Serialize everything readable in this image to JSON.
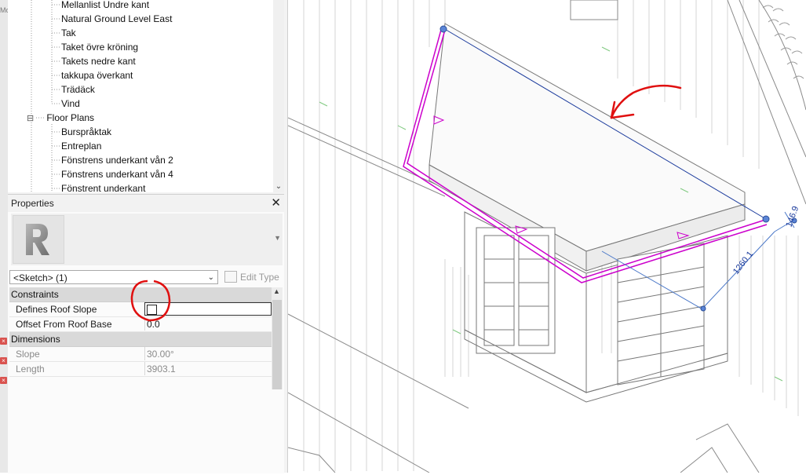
{
  "gutter": {
    "cut_label": "Mo",
    "error_marks": [
      "×",
      "×",
      "×"
    ]
  },
  "browser": {
    "items": [
      {
        "label": "Mellanlist Undre kant"
      },
      {
        "label": "Natural Ground Level East"
      },
      {
        "label": "Tak"
      },
      {
        "label": "Taket övre kröning"
      },
      {
        "label": "Takets nedre kant"
      },
      {
        "label": "takkupa överkant"
      },
      {
        "label": "Trädäck"
      },
      {
        "label": "Vind"
      },
      {
        "label": "Floor Plans",
        "toggle": "⊟"
      },
      {
        "label": "Burspråktak"
      },
      {
        "label": "Entreplan"
      },
      {
        "label": "Fönstrens underkant vån 2"
      },
      {
        "label": "Fönstrens underkant vån 4"
      },
      {
        "label": "Fönstrent underkant"
      }
    ],
    "scroll_down_glyph": "⌄"
  },
  "properties": {
    "title": "Properties",
    "close_glyph": "✕",
    "type_dropdown_glyph": "▼",
    "selector_value": "<Sketch> (1)",
    "selector_chevron": "⌄",
    "edit_type_label": "Edit Type",
    "scroll_up_glyph": "▲",
    "categories": [
      {
        "name": "Constraints",
        "rows": [
          {
            "label": "Defines Roof Slope",
            "value": "",
            "checkbox": true,
            "checked": false
          },
          {
            "label": "Offset From Roof Base",
            "value": "0.0"
          }
        ]
      },
      {
        "name": "Dimensions",
        "rows": [
          {
            "label": "Slope",
            "value": "30.00°",
            "readonly": true
          },
          {
            "label": "Length",
            "value": "3903.1",
            "readonly": true
          }
        ]
      }
    ]
  },
  "viewport": {
    "dimensions": [
      "146.9",
      "1260.1"
    ],
    "colors": {
      "sketch_line": "#cc00cc",
      "selected_line": "#1a3a9c",
      "dimension": "#4b78c8",
      "annotation": "#e01010",
      "model_line": "#8a8a8a",
      "grid": "#7fc97f"
    }
  }
}
